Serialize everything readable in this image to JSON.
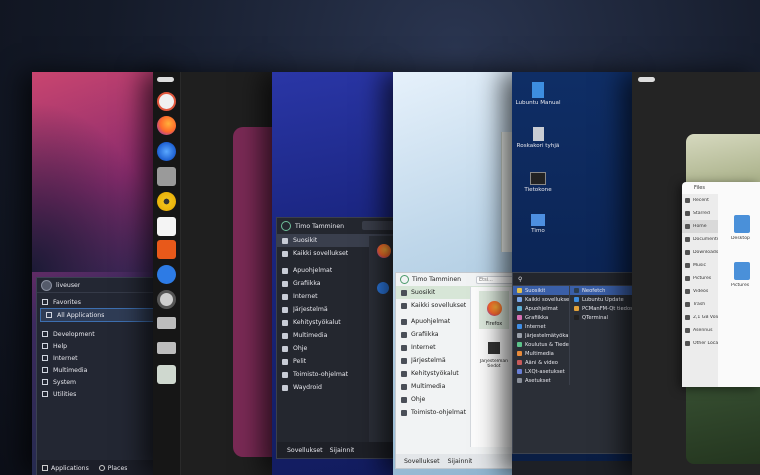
{
  "p1": {
    "user": "liveuser",
    "items": [
      "Favorites",
      "All Applications",
      "Development",
      "Help",
      "Internet",
      "Multimedia",
      "System",
      "Utilities"
    ],
    "selected_index": 1,
    "footer_tabs": [
      "Applications",
      "Places"
    ]
  },
  "p3": {
    "user": "Timo Tamminen",
    "items": [
      "Suosikit",
      "Kaikki sovellukset",
      "Apuohjelmat",
      "Grafiikka",
      "Internet",
      "Järjestelmä",
      "Kehitystyökalut",
      "Multimedia",
      "Ohje",
      "Pelit",
      "Toimisto-ohjelmat",
      "Waydroid"
    ],
    "selected_index": 0,
    "footer_tabs": [
      "Sovellukset",
      "Sijainnit"
    ]
  },
  "p4": {
    "user": "Timo Tamminen",
    "search_placeholder": "Etsi...",
    "items": [
      "Suosikit",
      "Kaikki sovellukset",
      "Apuohjelmat",
      "Grafiikka",
      "Internet",
      "Järjestelmä",
      "Kehitystyökalut",
      "Multimedia",
      "Ohje",
      "Toimisto-ohjelmat"
    ],
    "selected_index": 0,
    "tiles": [
      "Firefox",
      "Järjestelmän tiedot"
    ],
    "footer_tabs": [
      "Sovellukset",
      "Sijainnit"
    ]
  },
  "p5": {
    "desktop": [
      "Lubuntu Manual",
      "Roskakori tyhjä",
      "Tietokone",
      "Timo"
    ],
    "left_items": [
      "Suosikit",
      "Kaikki sovellukset",
      "Apuohjelmat",
      "Grafiikka",
      "Internet",
      "Järjestelmätyökalut",
      "Koulutus & Tiede",
      "Multimedia",
      "Ääni & video",
      "LXQt-asetukset",
      "Asetukset"
    ],
    "right_items": [
      "Neofetch",
      "Lubuntu Update",
      "PCManFM-Qt tiedostonhallinta",
      "QTerminal"
    ],
    "left_selected": 0,
    "right_selected": 0
  },
  "p6": {
    "window_title": "Files",
    "sidebar": [
      "Recent",
      "Starred",
      "Home",
      "Documents",
      "Downloads",
      "Music",
      "Pictures",
      "Videos",
      "Trash",
      "2,1 GB Volume",
      "Asennus",
      "Other Locations"
    ],
    "selected_index": 2,
    "folders": [
      "Desktop",
      "Pictures"
    ]
  }
}
